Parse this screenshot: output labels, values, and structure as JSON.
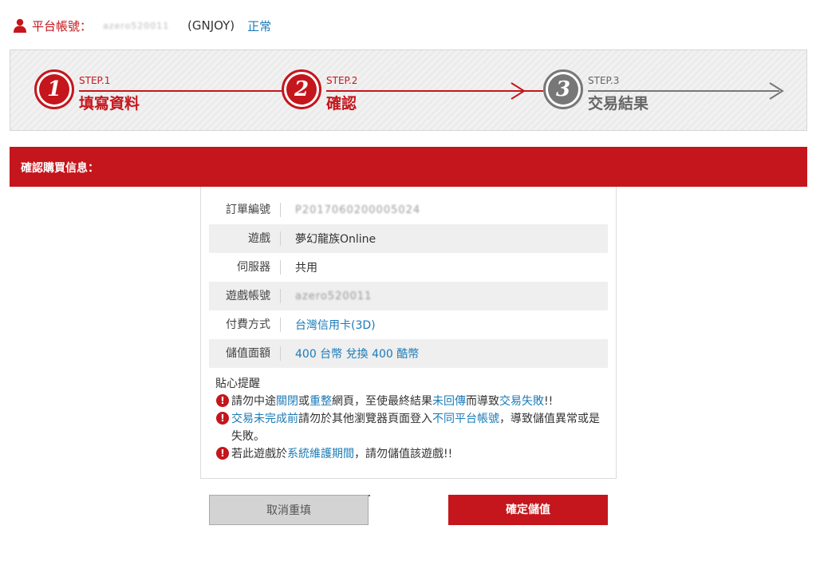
{
  "account": {
    "label": "平台帳號：",
    "id": "azero520011",
    "platform": "(GNJOY)",
    "status": "正常",
    "icon": "user-icon"
  },
  "steps": [
    {
      "num": "1",
      "small": "STEP.1",
      "big": "填寫資料",
      "state": "done"
    },
    {
      "num": "2",
      "small": "STEP.2",
      "big": "確認",
      "state": "active"
    },
    {
      "num": "3",
      "small": "STEP.3",
      "big": "交易結果",
      "state": "pending"
    }
  ],
  "confirm_bar": {
    "title": "確認購買信息："
  },
  "order": {
    "rows": [
      {
        "label": "訂單編號",
        "value": "P2017060200005024"
      },
      {
        "label": "遊戲",
        "value": "夢幻龍族Online"
      },
      {
        "label": "伺服器",
        "value": "共用"
      },
      {
        "label": "遊戲帳號",
        "value": "azero520011"
      },
      {
        "label": "付費方式",
        "value": "台灣信用卡(3D)"
      },
      {
        "label": "儲值面額",
        "value": "400 台幣 兌換 400 酷幣"
      }
    ]
  },
  "tips": {
    "title": "貼心提醒",
    "tip1": {
      "a": "請勿中途",
      "b": "關閉",
      "c": "或",
      "d": "重整",
      "e": "網頁，至使最終結果",
      "f": "未回傳",
      "g": "而導致",
      "h": "交易失敗",
      "i": "!!"
    },
    "tip2": {
      "a": "交易未完成前",
      "b": "請勿於其他瀏覽器頁面登入",
      "c": "不同平台帳號",
      "d": "，導致儲值異常或是失敗。"
    },
    "tip3": {
      "a": "若此遊戲於",
      "b": "系統維護期間",
      "c": "，請勿儲值該遊戲!!"
    },
    "warn_glyph": "!"
  },
  "buttons": {
    "cancel": "取消重填",
    "confirm": "確定儲值"
  },
  "colors": {
    "brand_red": "#c4161c",
    "link_blue": "#1b7bb8",
    "gray": "#777777"
  }
}
